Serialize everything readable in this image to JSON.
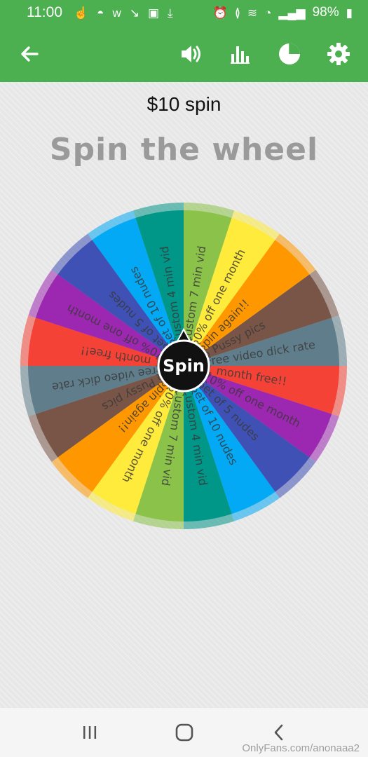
{
  "status_bar": {
    "time": "11:00",
    "battery": "98%",
    "left_icons": [
      "touch-icon",
      "snapchat-icon",
      "w-icon",
      "missed-call-icon",
      "image-icon",
      "download-icon"
    ],
    "right_icons": [
      "alarm-icon",
      "vibrate-icon",
      "wifi-icon",
      "volte-icon",
      "signal-icon",
      "battery-icon"
    ]
  },
  "app_bar": {
    "background": "#4caf50",
    "icons": [
      "back-arrow-icon",
      "volume-icon",
      "bar-chart-icon",
      "pie-chart-icon",
      "settings-icon"
    ]
  },
  "header": {
    "price_label": "$10 spin",
    "title": "Spin the wheel"
  },
  "wheel": {
    "center_label": "Spin",
    "segments": [
      {
        "label": "Custom 7 min vid",
        "color": "#8bc34a"
      },
      {
        "label": "50% off one month",
        "color": "#ffeb3b"
      },
      {
        "label": "Spin again!!",
        "color": "#ff9800"
      },
      {
        "label": "5 Pussy pics",
        "color": "#795548"
      },
      {
        "label": "Free video dick rate",
        "color": "#607d8b"
      },
      {
        "label": "1 month free!!",
        "color": "#f44336"
      },
      {
        "label": "70% off one month",
        "color": "#9c27b0"
      },
      {
        "label": "Set of 5 nudes",
        "color": "#3f51b5"
      },
      {
        "label": "Set of 10 nudes",
        "color": "#03a9f4"
      },
      {
        "label": "Custom 4 min vid",
        "color": "#009688"
      },
      {
        "label": "Custom 7 min vid",
        "color": "#8bc34a"
      },
      {
        "label": "50% off one month",
        "color": "#ffeb3b"
      },
      {
        "label": "Spin again!!",
        "color": "#ff9800"
      },
      {
        "label": "5 Pussy pics",
        "color": "#795548"
      },
      {
        "label": "Free video dick rate",
        "color": "#607d8b"
      },
      {
        "label": "1 month free!!",
        "color": "#f44336"
      },
      {
        "label": "70% off one month",
        "color": "#9c27b0"
      },
      {
        "label": "Set of 5 nudes",
        "color": "#3f51b5"
      },
      {
        "label": "Set of 10 nudes",
        "color": "#03a9f4"
      },
      {
        "label": "Custom 4 min vid",
        "color": "#009688"
      }
    ]
  },
  "nav_bar": {
    "icons": [
      "recent-apps-icon",
      "home-icon",
      "back-icon"
    ]
  },
  "watermark": "OnlyFans.com/anonaaa2"
}
